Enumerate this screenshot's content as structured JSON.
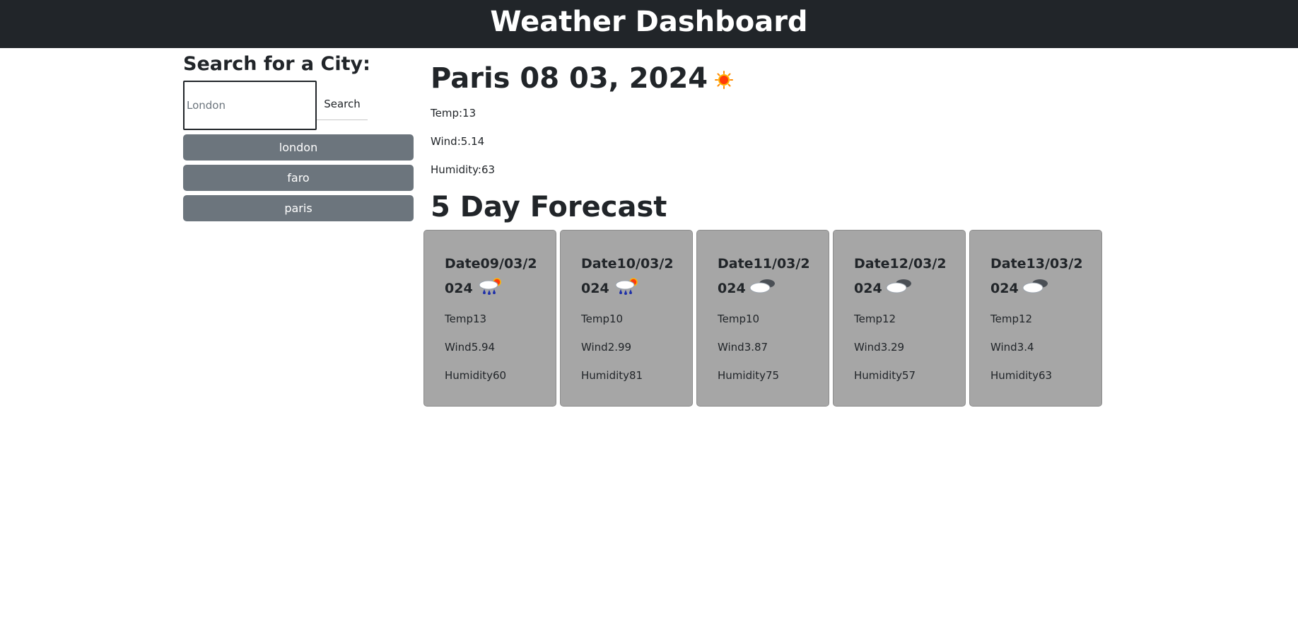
{
  "header": {
    "title": "Weather Dashboard"
  },
  "search": {
    "heading": "Search for a City:",
    "placeholder": "London",
    "value": "",
    "button_label": "Search",
    "history": [
      "london",
      "faro",
      "paris"
    ]
  },
  "current": {
    "heading": "Paris 08 03, 2024",
    "icon": "sun-icon",
    "temp": "Temp:13",
    "wind": "Wind:5.14",
    "humidity": "Humidity:63"
  },
  "forecast": {
    "heading": "5 Day Forecast",
    "days": [
      {
        "date": "Date09/03/2024",
        "icon": "rain-sun-icon",
        "temp": "Temp13",
        "wind": "Wind5.94",
        "humidity": "Humidity60"
      },
      {
        "date": "Date10/03/2024",
        "icon": "rain-sun-icon",
        "temp": "Temp10",
        "wind": "Wind2.99",
        "humidity": "Humidity81"
      },
      {
        "date": "Date11/03/2024",
        "icon": "cloud-icon",
        "temp": "Temp10",
        "wind": "Wind3.87",
        "humidity": "Humidity75"
      },
      {
        "date": "Date12/03/2024",
        "icon": "cloud-icon",
        "temp": "Temp12",
        "wind": "Wind3.29",
        "humidity": "Humidity57"
      },
      {
        "date": "Date13/03/2024",
        "icon": "cloud-icon",
        "temp": "Temp12",
        "wind": "Wind3.4",
        "humidity": "Humidity63"
      }
    ]
  },
  "colors": {
    "header_bg": "#212529",
    "history_button_bg": "#6c757d",
    "card_bg": "#a6a6a6"
  }
}
